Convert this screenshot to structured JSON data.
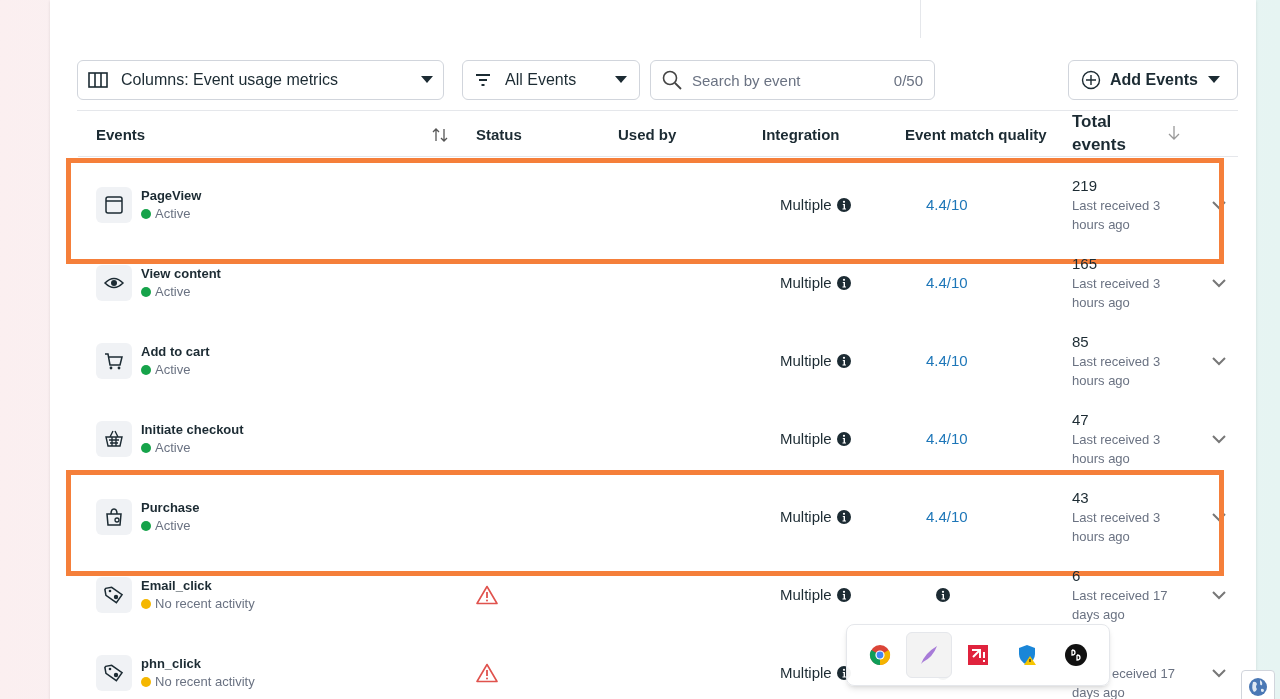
{
  "toolbar": {
    "columns_dropdown": "Columns: Event usage metrics",
    "filter_dropdown": "All Events",
    "search": {
      "placeholder": "Search by event",
      "counter": "0/50"
    },
    "add_button": "Add Events"
  },
  "table": {
    "columns": [
      "Events",
      "Status",
      "Used by",
      "Integration",
      "Event match quality",
      "Total events"
    ],
    "rows": [
      {
        "kind": "window",
        "name": "PageView",
        "status": "Active",
        "color": "#16a34a",
        "warning": false,
        "integration": "Multiple",
        "quality": "4.4/10",
        "total": "219",
        "last_received": "Last received 3 hours ago",
        "highlighted": true
      },
      {
        "kind": "eye",
        "name": "View content",
        "status": "Active",
        "color": "#16a34a",
        "warning": false,
        "integration": "Multiple",
        "quality": "4.4/10",
        "total": "165",
        "last_received": "Last received 3 hours ago",
        "highlighted": false
      },
      {
        "kind": "cart",
        "name": "Add to cart",
        "status": "Active",
        "color": "#16a34a",
        "warning": false,
        "integration": "Multiple",
        "quality": "4.4/10",
        "total": "85",
        "last_received": "Last received 3 hours ago",
        "highlighted": false
      },
      {
        "kind": "basket",
        "name": "Initiate checkout",
        "status": "Active",
        "color": "#16a34a",
        "warning": false,
        "integration": "Multiple",
        "quality": "4.4/10",
        "total": "47",
        "last_received": "Last received 3 hours ago",
        "highlighted": false
      },
      {
        "kind": "bag",
        "name": "Purchase",
        "status": "Active",
        "color": "#16a34a",
        "warning": false,
        "integration": "Multiple",
        "quality": "4.4/10",
        "total": "43",
        "last_received": "Last received 3 hours ago",
        "highlighted": true
      },
      {
        "kind": "tag",
        "name": "Email_click",
        "status": "No recent activity",
        "color": "#f5b700",
        "warning": true,
        "integration": "Multiple",
        "total": "6",
        "last_received": "Last received 17 days ago",
        "highlighted": false
      },
      {
        "kind": "tag",
        "name": "phn_click",
        "status": "No recent activity",
        "color": "#f5b700",
        "warning": true,
        "integration": "Multiple",
        "last_received": "eceived 17 days ago",
        "highlighted": false
      }
    ]
  },
  "taskbar_popup": {
    "items": [
      {
        "kind": "chrome",
        "selected": false
      },
      {
        "kind": "quill",
        "selected": true
      },
      {
        "kind": "red-app",
        "selected": false
      },
      {
        "kind": "shield",
        "selected": false
      },
      {
        "kind": "audio",
        "selected": false
      }
    ]
  }
}
